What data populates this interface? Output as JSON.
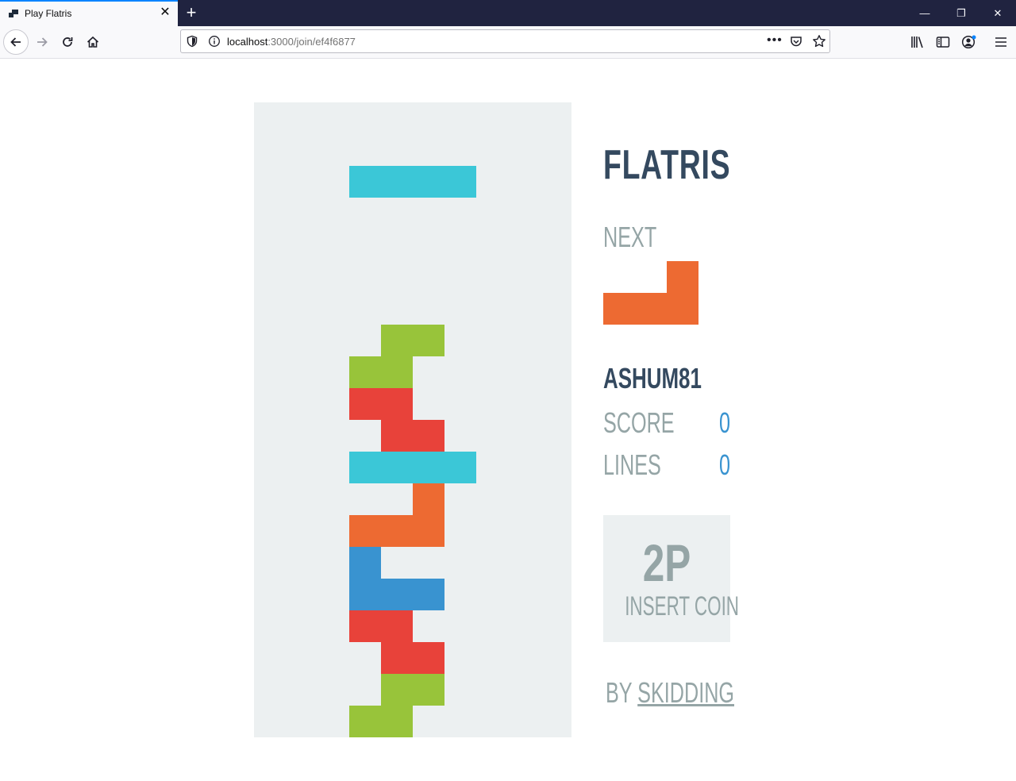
{
  "browser": {
    "tab_title": "Play Flatris",
    "tab_close": "✕",
    "new_tab": "+",
    "url_host": "localhost",
    "url_rest": ":3000/join/ef4f6877",
    "page_actions": "•••",
    "window_controls": {
      "minimize": "—",
      "restore": "❐",
      "close": "✕"
    }
  },
  "game": {
    "title": "FLATRIS",
    "next_label": "NEXT",
    "player_name": "ASHUM81",
    "score_label": "SCORE",
    "score_value": "0",
    "lines_label": "LINES",
    "lines_value": "0",
    "insert_coin": {
      "big": "2P",
      "small": "INSERT COIN"
    },
    "credit_prefix": "BY",
    "credit_link": "SKIDDING",
    "colors": {
      "cyan": "#3bc7d7",
      "green": "#98c43a",
      "red": "#e8423a",
      "orange": "#ed6a32",
      "blue": "#3993d0",
      "well": "#ecf0f1",
      "title": "#34495f",
      "muted": "#95a5a6"
    },
    "grid": {
      "cols": 10,
      "rows": 20
    },
    "active_piece": {
      "shape": "I",
      "color": "cyan",
      "cells": [
        [
          3,
          2
        ],
        [
          4,
          2
        ],
        [
          5,
          2
        ],
        [
          6,
          2
        ]
      ]
    },
    "next_piece": {
      "shape": "L",
      "color": "orange",
      "cells": [
        [
          2,
          0
        ],
        [
          0,
          1
        ],
        [
          1,
          1
        ],
        [
          2,
          1
        ]
      ]
    },
    "board_cells": [
      {
        "col": 4,
        "row": 7,
        "color": "green"
      },
      {
        "col": 5,
        "row": 7,
        "color": "green"
      },
      {
        "col": 3,
        "row": 8,
        "color": "green"
      },
      {
        "col": 4,
        "row": 8,
        "color": "green"
      },
      {
        "col": 3,
        "row": 9,
        "color": "red"
      },
      {
        "col": 4,
        "row": 9,
        "color": "red"
      },
      {
        "col": 4,
        "row": 10,
        "color": "red"
      },
      {
        "col": 5,
        "row": 10,
        "color": "red"
      },
      {
        "col": 3,
        "row": 11,
        "color": "cyan"
      },
      {
        "col": 4,
        "row": 11,
        "color": "cyan"
      },
      {
        "col": 5,
        "row": 11,
        "color": "cyan"
      },
      {
        "col": 6,
        "row": 11,
        "color": "cyan"
      },
      {
        "col": 5,
        "row": 12,
        "color": "orange"
      },
      {
        "col": 3,
        "row": 13,
        "color": "orange"
      },
      {
        "col": 4,
        "row": 13,
        "color": "orange"
      },
      {
        "col": 5,
        "row": 13,
        "color": "orange"
      },
      {
        "col": 3,
        "row": 14,
        "color": "blue"
      },
      {
        "col": 3,
        "row": 15,
        "color": "blue"
      },
      {
        "col": 4,
        "row": 15,
        "color": "blue"
      },
      {
        "col": 5,
        "row": 15,
        "color": "blue"
      },
      {
        "col": 3,
        "row": 16,
        "color": "red"
      },
      {
        "col": 4,
        "row": 16,
        "color": "red"
      },
      {
        "col": 4,
        "row": 17,
        "color": "red"
      },
      {
        "col": 5,
        "row": 17,
        "color": "red"
      },
      {
        "col": 4,
        "row": 18,
        "color": "green"
      },
      {
        "col": 5,
        "row": 18,
        "color": "green"
      },
      {
        "col": 3,
        "row": 19,
        "color": "green"
      },
      {
        "col": 4,
        "row": 19,
        "color": "green"
      }
    ]
  }
}
